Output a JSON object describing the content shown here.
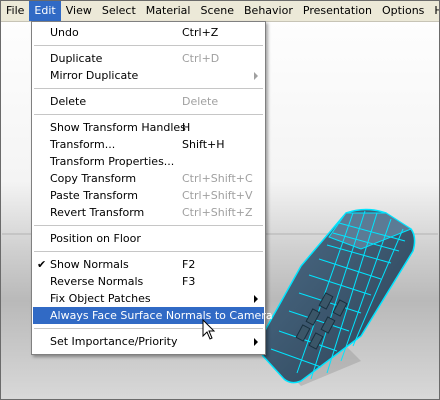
{
  "menubar": {
    "items": [
      "File",
      "Edit",
      "View",
      "Select",
      "Material",
      "Scene",
      "Behavior",
      "Presentation",
      "Options",
      "Help"
    ]
  },
  "edit_menu": {
    "undo": {
      "label": "Undo",
      "shortcut": "Ctrl+Z"
    },
    "duplicate": {
      "label": "Duplicate",
      "shortcut": "Ctrl+D"
    },
    "mirror_duplicate": {
      "label": "Mirror Duplicate"
    },
    "delete": {
      "label": "Delete",
      "shortcut": "Delete"
    },
    "show_transform_handles": {
      "label": "Show Transform Handles",
      "shortcut": "H"
    },
    "transform": {
      "label": "Transform...",
      "shortcut": "Shift+H"
    },
    "transform_properties": {
      "label": "Transform Properties..."
    },
    "copy_transform": {
      "label": "Copy Transform",
      "shortcut": "Ctrl+Shift+C"
    },
    "paste_transform": {
      "label": "Paste Transform",
      "shortcut": "Ctrl+Shift+V"
    },
    "revert_transform": {
      "label": "Revert Transform",
      "shortcut": "Ctrl+Shift+Z"
    },
    "position_on_floor": {
      "label": "Position on Floor"
    },
    "show_normals": {
      "label": "Show Normals",
      "shortcut": "F2",
      "checked": true
    },
    "reverse_normals": {
      "label": "Reverse Normals",
      "shortcut": "F3"
    },
    "fix_object_patches": {
      "label": "Fix Object Patches"
    },
    "always_face_surface_normals": {
      "label": "Always Face Surface Normals to Camera",
      "highlighted": true
    },
    "set_importance_priority": {
      "label": "Set Importance/Priority"
    }
  },
  "colors": {
    "menu_highlight": "#316ac5",
    "menubar_bg": "#ece9d8",
    "model_fill": "#3c5a74",
    "model_wire": "#00ffff"
  }
}
